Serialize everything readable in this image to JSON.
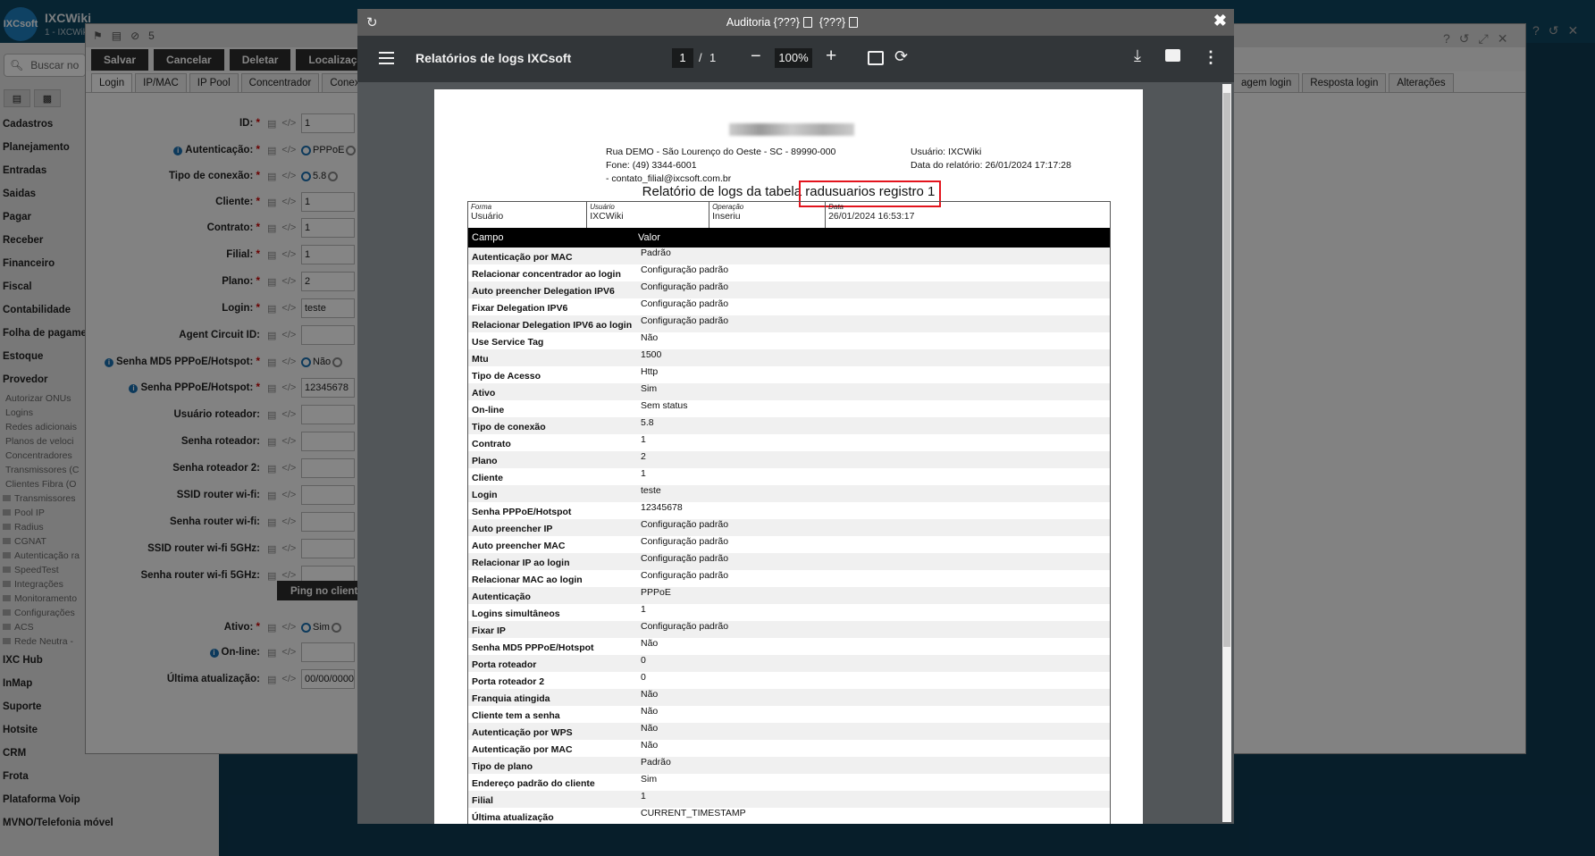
{
  "app": {
    "name": "IXCWiki",
    "subtitle": "1 - IXCWiki",
    "logo_text": "IXCsoft",
    "search_placeholder": "Buscar no"
  },
  "sidebar": {
    "items": [
      {
        "label": "Cadastros",
        "type": "item"
      },
      {
        "label": "Planejamento",
        "type": "item"
      },
      {
        "label": "Entradas",
        "type": "item"
      },
      {
        "label": "Saidas",
        "type": "item"
      },
      {
        "label": "Pagar",
        "type": "item"
      },
      {
        "label": "Receber",
        "type": "item"
      },
      {
        "label": "Financeiro",
        "type": "item"
      },
      {
        "label": "Fiscal",
        "type": "item"
      },
      {
        "label": "Contabilidade",
        "type": "item"
      },
      {
        "label": "Folha de pagame",
        "type": "item"
      },
      {
        "label": "Estoque",
        "type": "item"
      },
      {
        "label": "Provedor",
        "type": "item"
      },
      {
        "label": "Autorizar ONUs",
        "type": "sub"
      },
      {
        "label": "Logins",
        "type": "sub"
      },
      {
        "label": "Redes adicionais",
        "type": "sub"
      },
      {
        "label": "Planos de veloci",
        "type": "sub"
      },
      {
        "label": "Concentradores",
        "type": "sub"
      },
      {
        "label": "Transmissores (C",
        "type": "sub"
      },
      {
        "label": "Clientes Fibra (O",
        "type": "sub"
      },
      {
        "label": "Transmissores",
        "type": "folder"
      },
      {
        "label": "Pool IP",
        "type": "folder"
      },
      {
        "label": "Radius",
        "type": "folder"
      },
      {
        "label": "CGNAT",
        "type": "folder"
      },
      {
        "label": "Autenticação ra",
        "type": "folder"
      },
      {
        "label": "SpeedTest",
        "type": "folder"
      },
      {
        "label": "Integrações",
        "type": "folder"
      },
      {
        "label": "Monitoramento",
        "type": "folder"
      },
      {
        "label": "Configurações",
        "type": "folder"
      },
      {
        "label": "ACS",
        "type": "folder"
      },
      {
        "label": "Rede Neutra -",
        "type": "folder"
      },
      {
        "label": "IXC Hub",
        "type": "item"
      },
      {
        "label": "InMap",
        "type": "item"
      },
      {
        "label": "Suporte",
        "type": "item"
      },
      {
        "label": "Hotsite",
        "type": "item"
      },
      {
        "label": "CRM",
        "type": "item"
      },
      {
        "label": "Frota",
        "type": "item"
      },
      {
        "label": "Plataforma Voip",
        "type": "item"
      },
      {
        "label": "MVNO/Telefonia móvel",
        "type": "item"
      }
    ]
  },
  "form": {
    "title_count": "5",
    "toolbar": [
      "Salvar",
      "Cancelar",
      "Deletar",
      "Localização"
    ],
    "tabs": [
      "Login",
      "IP/MAC",
      "IP Pool",
      "Concentrador",
      "Conex"
    ],
    "right_tabs": [
      "agem login",
      "Resposta login",
      "Alterações"
    ],
    "fields": [
      {
        "label": "ID:",
        "required": true,
        "info": false,
        "kind": "input",
        "value": "1"
      },
      {
        "label": "Autenticação:",
        "required": true,
        "info": true,
        "kind": "radio",
        "value": "PPPoE"
      },
      {
        "label": "Tipo de conexão:",
        "required": true,
        "info": false,
        "kind": "radio",
        "value": "5.8"
      },
      {
        "label": "Cliente:",
        "required": true,
        "info": false,
        "kind": "input",
        "value": "1"
      },
      {
        "label": "Contrato:",
        "required": true,
        "info": false,
        "kind": "input",
        "value": "1"
      },
      {
        "label": "Filial:",
        "required": true,
        "info": false,
        "kind": "input",
        "value": "1"
      },
      {
        "label": "Plano:",
        "required": true,
        "info": false,
        "kind": "input",
        "value": "2"
      },
      {
        "label": "Login:",
        "required": true,
        "info": false,
        "kind": "input",
        "value": "teste"
      },
      {
        "label": "Agent Circuit ID:",
        "required": false,
        "info": false,
        "kind": "input",
        "value": ""
      },
      {
        "label": "Senha MD5 PPPoE/Hotspot:",
        "required": true,
        "info": true,
        "kind": "radio",
        "value": "Não"
      },
      {
        "label": "Senha PPPoE/Hotspot:",
        "required": true,
        "info": true,
        "kind": "input",
        "value": "12345678"
      },
      {
        "label": "Usuário roteador:",
        "required": false,
        "info": false,
        "kind": "input",
        "value": ""
      },
      {
        "label": "Senha roteador:",
        "required": false,
        "info": false,
        "kind": "input",
        "value": ""
      },
      {
        "label": "Senha roteador 2:",
        "required": false,
        "info": false,
        "kind": "input",
        "value": ""
      },
      {
        "label": "SSID router wi-fi:",
        "required": false,
        "info": false,
        "kind": "input",
        "value": ""
      },
      {
        "label": "Senha router wi-fi:",
        "required": false,
        "info": false,
        "kind": "input",
        "value": ""
      },
      {
        "label": "SSID router wi-fi 5GHz:",
        "required": false,
        "info": false,
        "kind": "input",
        "value": ""
      },
      {
        "label": "Senha router wi-fi 5GHz:",
        "required": false,
        "info": false,
        "kind": "input",
        "value": ""
      },
      {
        "label": "Ativo:",
        "required": true,
        "info": false,
        "kind": "radio",
        "value": "Sim"
      },
      {
        "label": "On-line:",
        "required": false,
        "info": true,
        "kind": "input",
        "value": ""
      },
      {
        "label": "Última atualização:",
        "required": false,
        "info": false,
        "kind": "input",
        "value": "00/00/0000"
      }
    ],
    "ping_button": "Ping no cliente"
  },
  "dialog": {
    "title_a": "Auditoria {???}",
    "title_b": "{???}",
    "pdf": {
      "title": "Relatórios de logs IXCsoft",
      "page_current": "1",
      "page_sep": "/",
      "page_total": "1",
      "zoom": "100%"
    }
  },
  "report": {
    "address": "Rua DEMO - São Lourenço do Oeste - SC - 89990-000",
    "phone": "Fone: (49) 3344-6001",
    "email": " - contato_filial@ixcsoft.com.br",
    "user": "Usuário: IXCWiki",
    "report_date": "Data do relatório: 26/01/2024 17:17:28",
    "title": "Relatório de logs da tabela radusuarios registro 1",
    "info_captions": [
      "Forma",
      "Usuário",
      "Operação",
      "Data"
    ],
    "info_values": [
      "Usuário",
      "IXCWiki",
      "Inseriu",
      "26/01/2024 16:53:17"
    ],
    "columns": [
      "Campo",
      "Valor"
    ],
    "rows": [
      [
        "Autenticação por MAC",
        "Padrão"
      ],
      [
        "Relacionar concentrador ao login",
        "Configuração padrão"
      ],
      [
        "Auto preencher Delegation IPV6",
        "Configuração padrão"
      ],
      [
        "Fixar Delegation IPV6",
        "Configuração padrão"
      ],
      [
        "Relacionar Delegation IPV6 ao login",
        "Configuração padrão"
      ],
      [
        "Use Service Tag",
        "Não"
      ],
      [
        "Mtu",
        "1500"
      ],
      [
        "Tipo de Acesso",
        "Http"
      ],
      [
        "Ativo",
        "Sim"
      ],
      [
        "On-line",
        "Sem status"
      ],
      [
        "Tipo de conexão",
        "5.8"
      ],
      [
        "Contrato",
        "1"
      ],
      [
        "Plano",
        "2"
      ],
      [
        "Cliente",
        "1"
      ],
      [
        "Login",
        "teste"
      ],
      [
        "Senha PPPoE/Hotspot",
        "12345678"
      ],
      [
        "Auto preencher IP",
        "Configuração padrão"
      ],
      [
        "Auto preencher MAC",
        "Configuração padrão"
      ],
      [
        "Relacionar IP ao login",
        "Configuração padrão"
      ],
      [
        "Relacionar MAC ao login",
        "Configuração padrão"
      ],
      [
        "Autenticação",
        "PPPoE"
      ],
      [
        "Logins simultâneos",
        "1"
      ],
      [
        "Fixar IP",
        "Configuração padrão"
      ],
      [
        "Senha MD5 PPPoE/Hotspot",
        "Não"
      ],
      [
        "Porta roteador",
        "0"
      ],
      [
        "Porta roteador 2",
        "0"
      ],
      [
        "Franquia atingida",
        "Não"
      ],
      [
        "Cliente tem a senha",
        "Não"
      ],
      [
        "Autenticação por WPS",
        "Não"
      ],
      [
        "Autenticação por MAC",
        "Não"
      ],
      [
        "Tipo de plano",
        "Padrão"
      ],
      [
        "Endereço padrão do cliente",
        "Sim"
      ],
      [
        "Filial",
        "1"
      ],
      [
        "Última atualização",
        "CURRENT_TIMESTAMP"
      ]
    ]
  },
  "colors": {
    "highlight": "#e3141d",
    "pdf_toolbar": "#323639",
    "dialog_title": "#5c5c5c"
  }
}
